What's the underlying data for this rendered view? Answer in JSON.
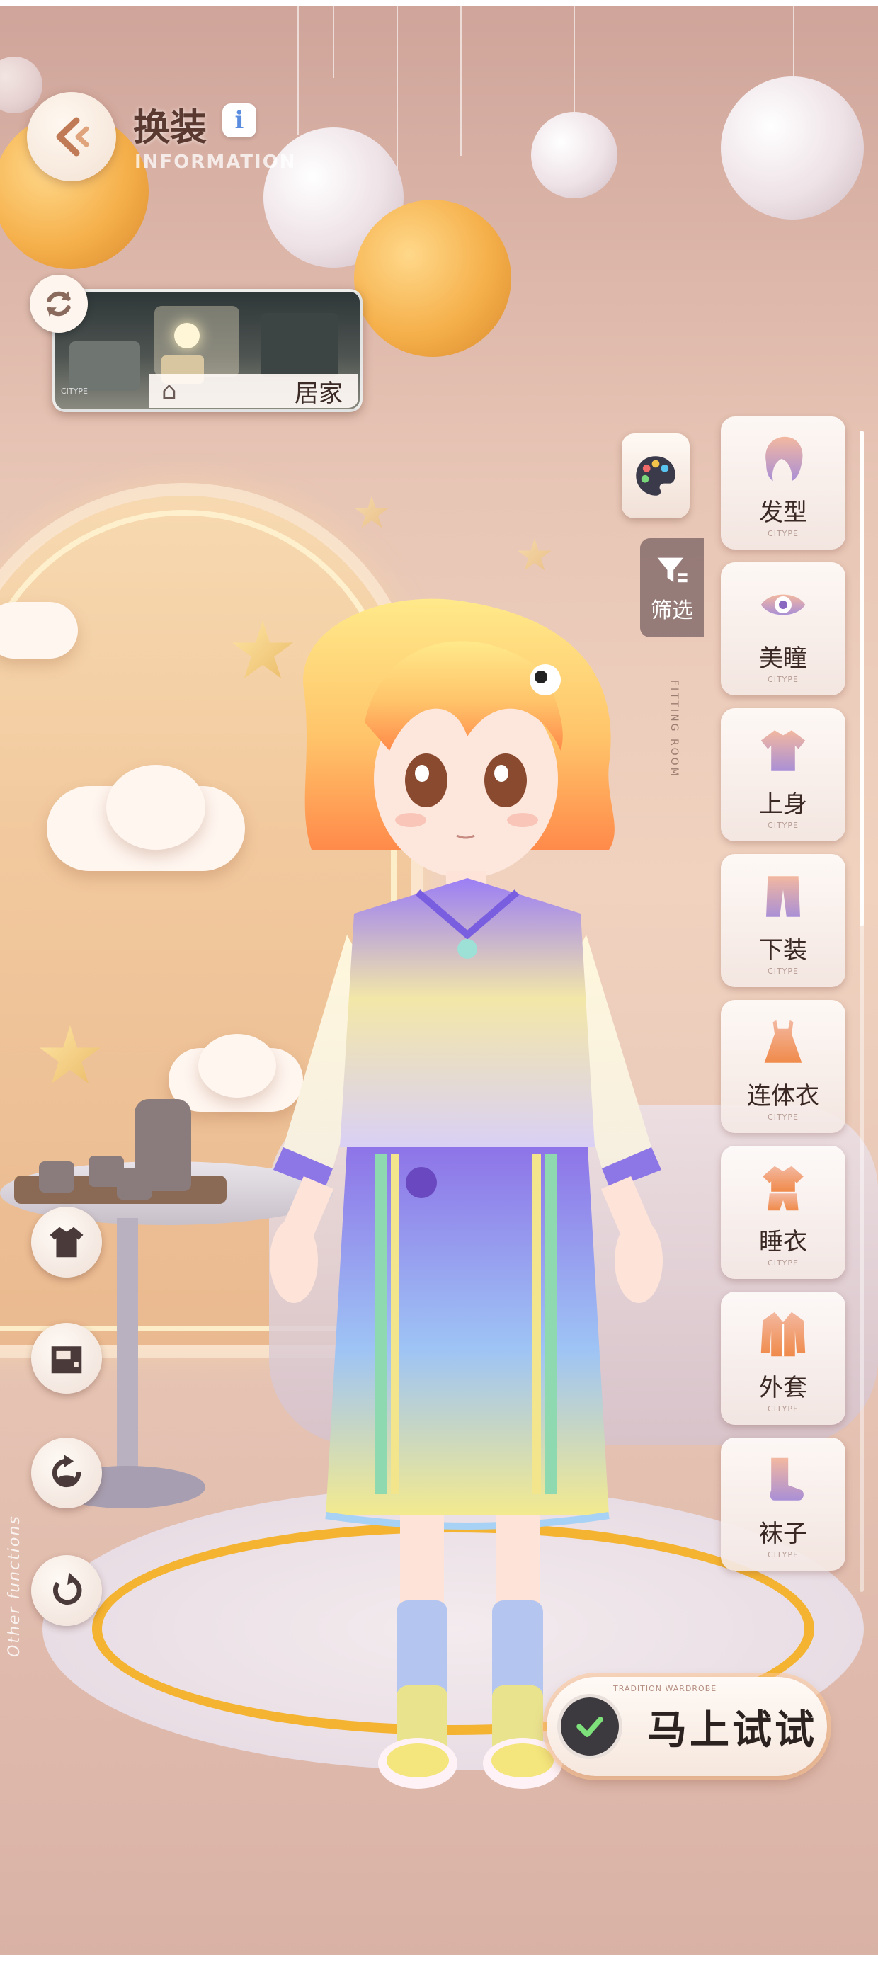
{
  "header": {
    "title": "换装",
    "subtitle": "INFORMATION",
    "info_icon": "i"
  },
  "scene": {
    "label": "居家",
    "tag": "CITYPE"
  },
  "side_panel": {
    "filter_label": "筛选",
    "vertical_text": "FITTING ROOM",
    "categories": [
      {
        "label": "发型",
        "icon": "hair-icon",
        "sub": "CITYPE"
      },
      {
        "label": "美瞳",
        "icon": "eye-icon",
        "sub": "CITYPE"
      },
      {
        "label": "上身",
        "icon": "top-icon",
        "sub": "CITYPE"
      },
      {
        "label": "下装",
        "icon": "bottom-icon",
        "sub": "CITYPE"
      },
      {
        "label": "连体衣",
        "icon": "dress-icon",
        "sub": "CITYPE"
      },
      {
        "label": "睡衣",
        "icon": "pajamas-icon",
        "sub": "CITYPE"
      },
      {
        "label": "外套",
        "icon": "coat-icon",
        "sub": "CITYPE"
      },
      {
        "label": "袜子",
        "icon": "socks-icon",
        "sub": "CITYPE"
      }
    ]
  },
  "left_functions": {
    "vertical_text": "Other functions",
    "buttons": [
      "outfit-icon",
      "wardrobe-icon",
      "rotate-icon",
      "reset-icon"
    ]
  },
  "try_button": {
    "label": "马上试试",
    "tag": "TRADITION WARDROBE"
  },
  "colors": {
    "accent_text": "#3a2824",
    "panel_bg": "#fbf4f1",
    "icon_gradient_top": "#f3b8a0",
    "icon_gradient_bottom": "#a98fd6",
    "rug_ring": "#f4b330"
  }
}
